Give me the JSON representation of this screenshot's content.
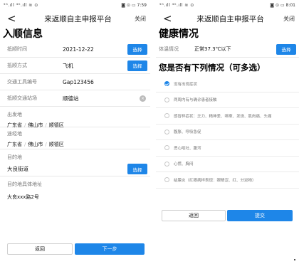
{
  "left": {
    "status": {
      "signal": "⁵ᴳ.ıll ⁴ᴳ.ıll ≋ ⊙",
      "right": "◙ ⊙ ▭ 7:59"
    },
    "nav": {
      "back": "<",
      "title": "来返顺自主申报平台",
      "close": "关闭"
    },
    "heading": "入顺信息",
    "rows": {
      "arrival_time": {
        "label": "抵顺时间",
        "value": "2021-12-22",
        "button": "选择"
      },
      "arrival_mode": {
        "label": "抵顺方式",
        "value": "飞机",
        "button": "选择"
      },
      "vehicle_no": {
        "label": "交通工具编号",
        "value": "Gap123456"
      },
      "station": {
        "label": "抵顺交通站场",
        "value": "顺德站",
        "clear": "×"
      }
    },
    "origin": {
      "label": "出发地",
      "province": "广东省",
      "city": "佛山市",
      "district": "顺德区",
      "sep": "/"
    },
    "transit": {
      "label": "途经地",
      "province": "广东省",
      "city": "佛山市",
      "district": "顺德区",
      "sep": "/"
    },
    "destination": {
      "label": "目的地",
      "value": "大良街道",
      "button": "选择"
    },
    "dest_address": {
      "label": "目的地具体地址",
      "value": "大良xxx路2号"
    },
    "buttons": {
      "back": "返回",
      "next": "下一步"
    }
  },
  "right": {
    "status": {
      "signal": "⁵ᴳ.ıll ⁴ᴳ.ıll ≋ ⊙",
      "right": "◙ ⊙ ▭ 8:01"
    },
    "nav": {
      "back": "<",
      "title": "来返顺自主申报平台",
      "close": "关闭"
    },
    "heading": "健康情况",
    "temperature": {
      "label": "体温情况",
      "value": "正常37.3℃以下",
      "button": "选择"
    },
    "question": "您是否有下列情况（可多选）",
    "options": [
      {
        "label": "没有出现症状",
        "checked": true
      },
      {
        "label": "两周内有与确诊患者接触",
        "checked": false
      },
      {
        "label": "感冒样症状：乏力、精神差、咳嗽、发烧、肌肉痛、头痛",
        "checked": false
      },
      {
        "label": "腹胀、呼吸急促",
        "checked": false
      },
      {
        "label": "恶心呕吐、腹泻",
        "checked": false
      },
      {
        "label": "心慌、胸闷",
        "checked": false
      },
      {
        "label": "结膜炎（红眼病样表现：眼睛涩、红、分泌物）",
        "checked": false
      }
    ],
    "buttons": {
      "back": "返回",
      "submit": "提交"
    }
  },
  "colors": {
    "primary": "#1e86e8",
    "divider": "#e8e8e8"
  }
}
